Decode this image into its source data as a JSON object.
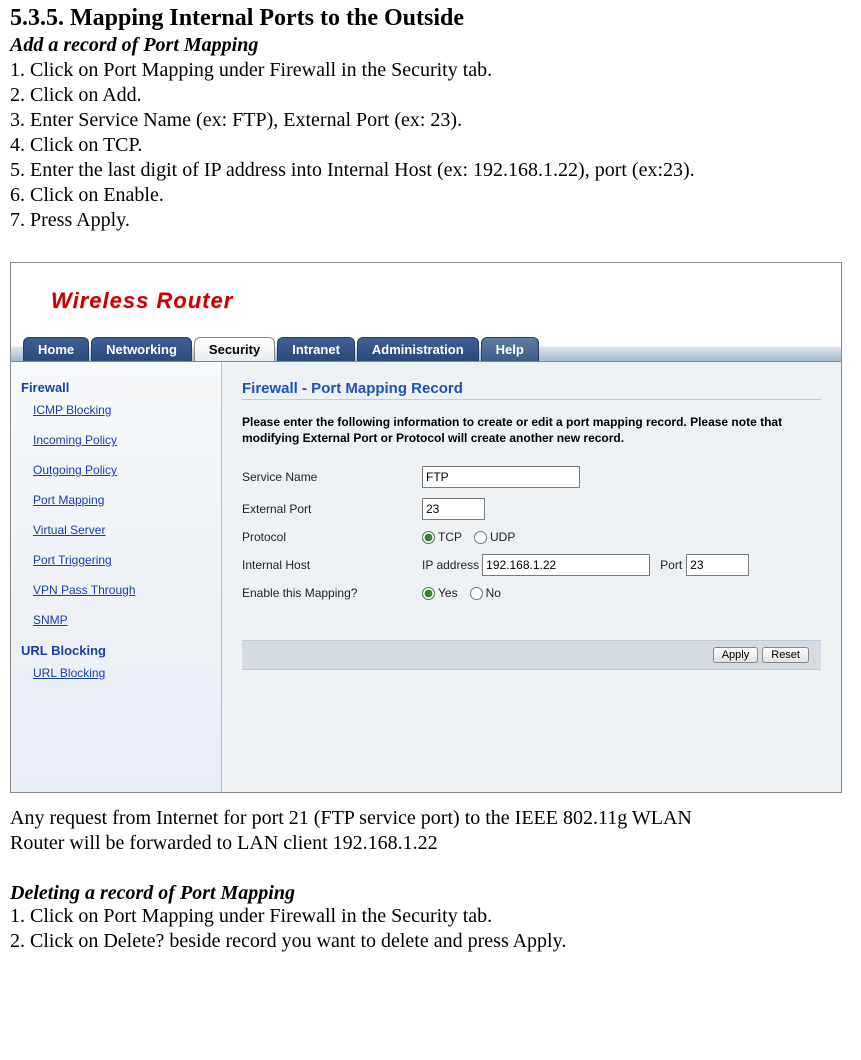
{
  "doc": {
    "section_title": "5.3.5. Mapping Internal Ports to the Outside",
    "add_title": "Add a record of Port Mapping",
    "steps": [
      "1. Click on Port Mapping under Firewall in the Security tab.",
      "2. Click on Add.",
      "3. Enter Service Name (ex: FTP), External Port (ex: 23).",
      "4. Click on TCP.",
      "5. Enter the last digit of IP address into Internal Host (ex: 192.168.1.22), port (ex:23).",
      "6. Click on Enable.",
      "7. Press Apply."
    ],
    "post_line1": "Any request from Internet for port 21 (FTP service port) to the IEEE 802.11g WLAN",
    "post_line2": "Router will be forwarded to LAN client 192.168.1.22",
    "delete_title": "Deleting a record of Port Mapping",
    "del_steps": [
      "1. Click on Port Mapping under Firewall in the Security tab.",
      "2. Click on Delete? beside record you want to delete and press Apply."
    ]
  },
  "ui": {
    "logo": "Wireless Router",
    "tabs": {
      "home": "Home",
      "networking": "Networking",
      "security": "Security",
      "intranet": "Intranet",
      "administration": "Administration",
      "help": "Help"
    },
    "sidebar": {
      "firewall_head": "Firewall",
      "links": {
        "icmp": "ICMP Blocking",
        "incoming": "Incoming Policy",
        "outgoing": "Outgoing Policy",
        "portmap": "Port Mapping",
        "virtual": "Virtual Server",
        "trigger": "Port Triggering",
        "vpn": "VPN Pass Through",
        "snmp": "SNMP"
      },
      "url_head": "URL Blocking",
      "url_link": "URL Blocking"
    },
    "content": {
      "title": "Firewall - Port Mapping Record",
      "intro": "Please enter the following information to create or edit a port mapping record. Please note that modifying External Port or Protocol will create another new record.",
      "labels": {
        "service": "Service Name",
        "external": "External Port",
        "protocol": "Protocol",
        "internal": "Internal Host",
        "enable": "Enable this Mapping?",
        "ip_prefix": "IP address",
        "port_suffix": "Port"
      },
      "values": {
        "service": "FTP",
        "external": "23",
        "tcp": "TCP",
        "udp": "UDP",
        "ip": "192.168.1.22",
        "port": "23",
        "yes": "Yes",
        "no": "No"
      },
      "buttons": {
        "apply": "Apply",
        "reset": "Reset"
      }
    }
  }
}
